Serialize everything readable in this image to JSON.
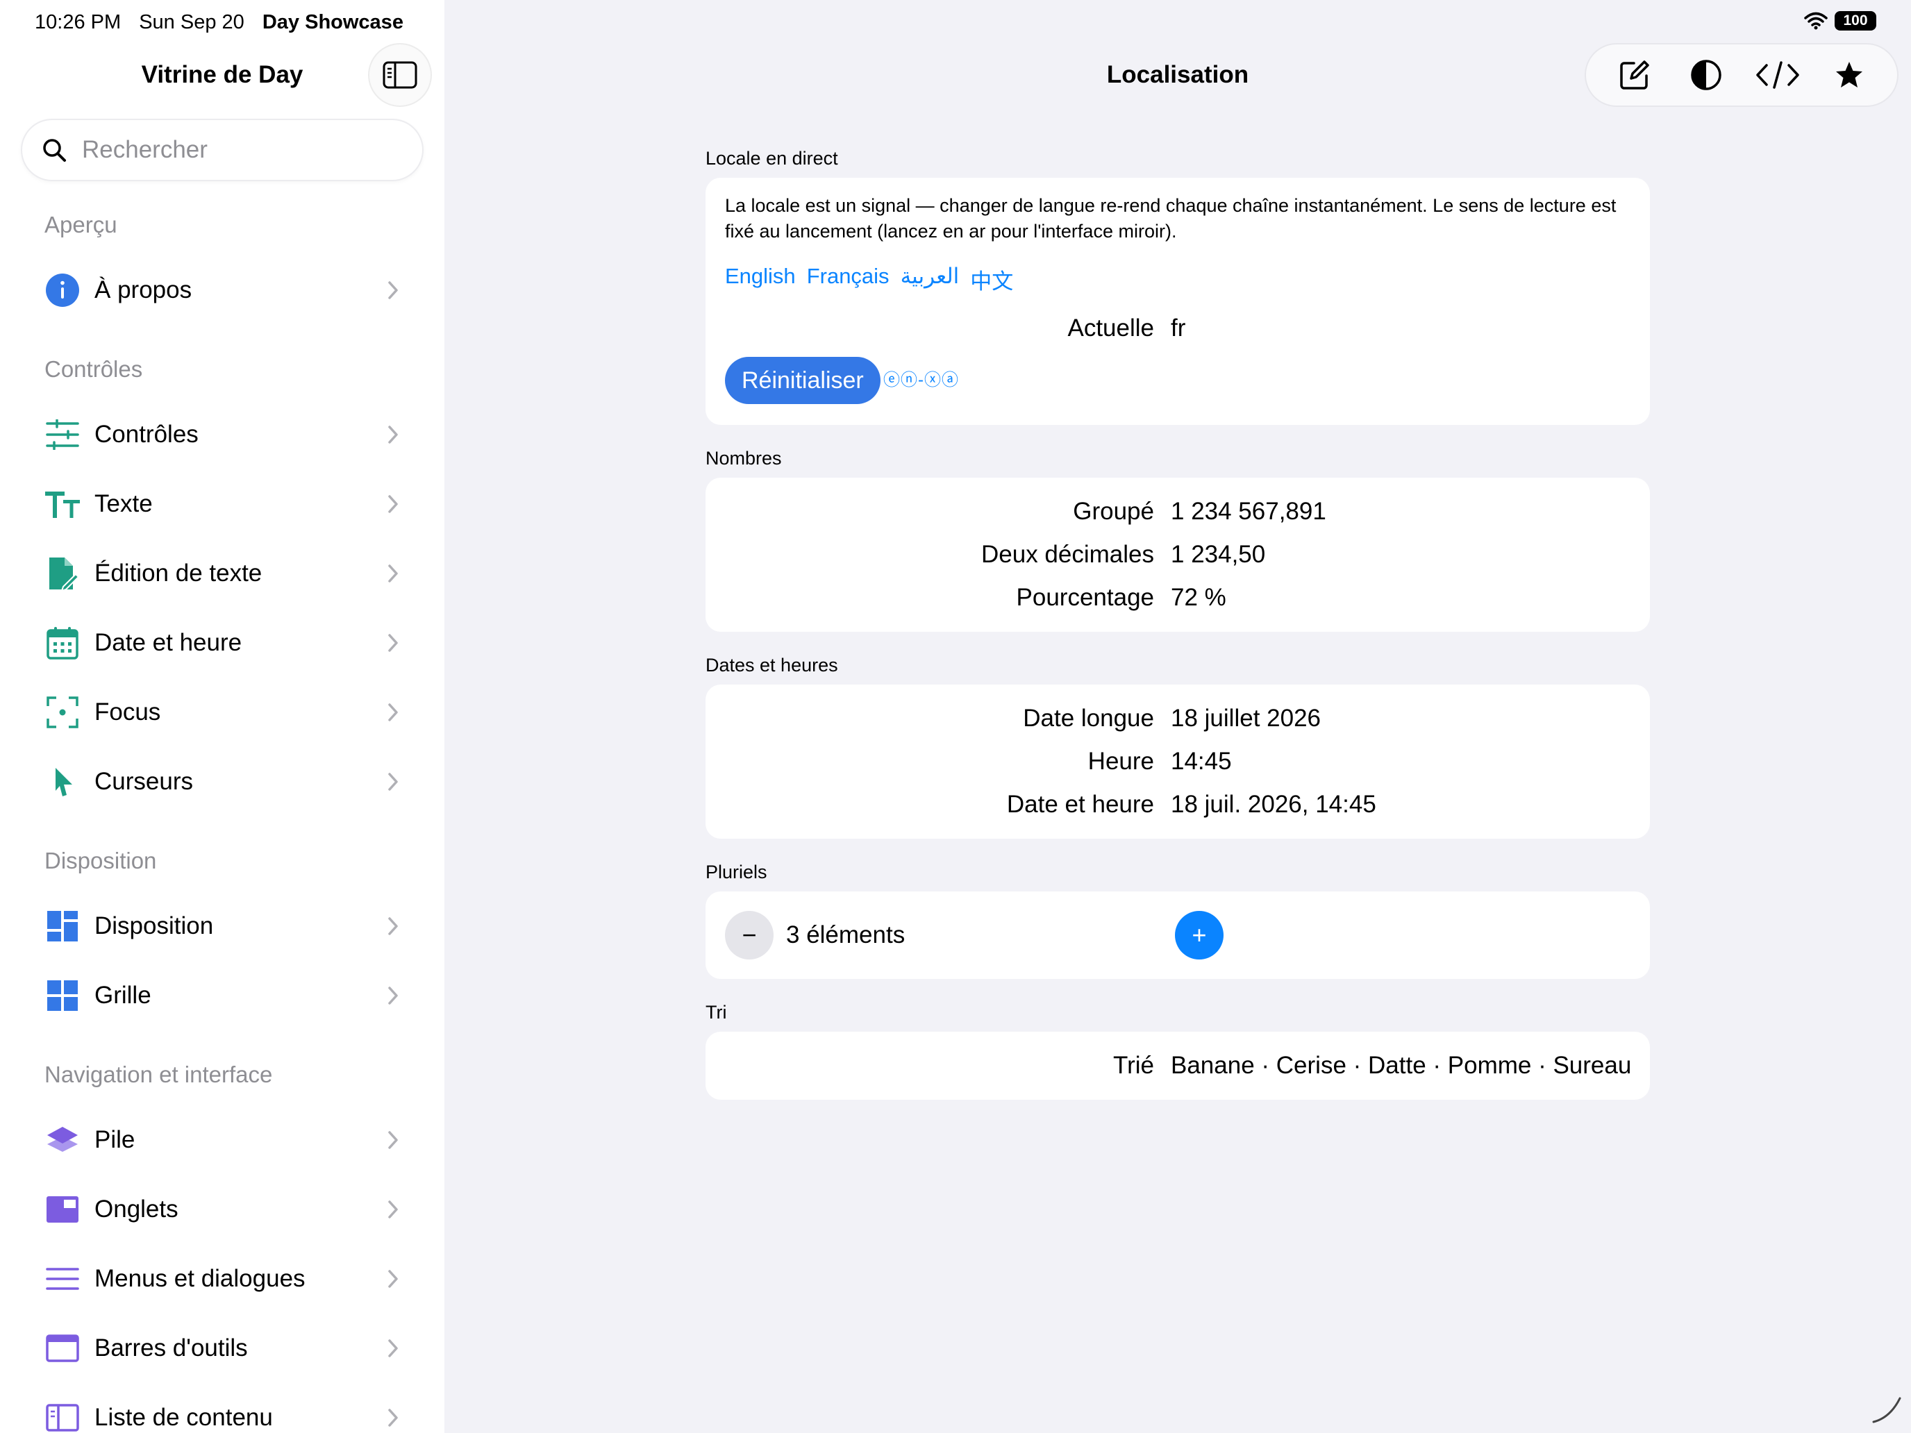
{
  "status": {
    "time": "10:26 PM",
    "date": "Sun Sep 20",
    "app": "Day Showcase",
    "battery": "100"
  },
  "sidebar": {
    "title": "Vitrine de Day",
    "search_placeholder": "Rechercher",
    "sections": [
      {
        "header": "Aperçu",
        "items": [
          {
            "label": "À propos",
            "icon": "info-icon",
            "color": "#3478e6"
          }
        ]
      },
      {
        "header": "Contrôles",
        "items": [
          {
            "label": "Contrôles",
            "icon": "sliders-icon",
            "color": "#1f9e84"
          },
          {
            "label": "Texte",
            "icon": "text-size-icon",
            "color": "#1f9e84"
          },
          {
            "label": "Édition de texte",
            "icon": "document-edit-icon",
            "color": "#1f9e84"
          },
          {
            "label": "Date et heure",
            "icon": "calendar-icon",
            "color": "#1f9e84"
          },
          {
            "label": "Focus",
            "icon": "focus-icon",
            "color": "#1f9e84"
          },
          {
            "label": "Curseurs",
            "icon": "cursor-icon",
            "color": "#1f9e84"
          }
        ]
      },
      {
        "header": "Disposition",
        "items": [
          {
            "label": "Disposition",
            "icon": "layout-icon",
            "color": "#3478e6"
          },
          {
            "label": "Grille",
            "icon": "grid-icon",
            "color": "#3478e6"
          }
        ]
      },
      {
        "header": "Navigation et interface",
        "items": [
          {
            "label": "Pile",
            "icon": "stack-icon",
            "color": "#7c5ce0"
          },
          {
            "label": "Onglets",
            "icon": "tabs-icon",
            "color": "#7c5ce0"
          },
          {
            "label": "Menus et dialogues",
            "icon": "menu-lines-icon",
            "color": "#7c5ce0"
          },
          {
            "label": "Barres d'outils",
            "icon": "toolbar-icon",
            "color": "#7c5ce0"
          },
          {
            "label": "Liste de contenu",
            "icon": "sidebar-list-icon",
            "color": "#7c5ce0"
          }
        ]
      }
    ]
  },
  "main": {
    "title": "Localisation",
    "toolbar": [
      "compose-icon",
      "contrast-icon",
      "code-icon",
      "star-icon"
    ],
    "live_locale": {
      "label": "Locale en direct",
      "description": "La locale est un signal — changer de langue re-rend chaque chaîne instantanément. Le sens de lecture est fixé au lancement (lancez en ar pour l'interface miroir).",
      "languages": [
        "English",
        "Français",
        "العربية",
        "中文"
      ],
      "current_key": "Actuelle",
      "current_value": "fr",
      "reset_label": "Réinitialiser",
      "pseudo_locale": "ⓔⓝ-ⓧⓐ"
    },
    "numbers": {
      "label": "Nombres",
      "rows": [
        {
          "k": "Groupé",
          "v": "1 234 567,891"
        },
        {
          "k": "Deux décimales",
          "v": "1 234,50"
        },
        {
          "k": "Pourcentage",
          "v": "72 %"
        }
      ]
    },
    "dates": {
      "label": "Dates et heures",
      "rows": [
        {
          "k": "Date longue",
          "v": "18 juillet 2026"
        },
        {
          "k": "Heure",
          "v": "14:45"
        },
        {
          "k": "Date et heure",
          "v": "18 juil. 2026, 14:45"
        }
      ]
    },
    "plurals": {
      "label": "Pluriels",
      "minus": "−",
      "count_text": "3 éléments",
      "plus": "+"
    },
    "sorting": {
      "label": "Tri",
      "k": "Trié",
      "v": "Banane · Cerise · Datte · Pomme · Sureau"
    }
  }
}
